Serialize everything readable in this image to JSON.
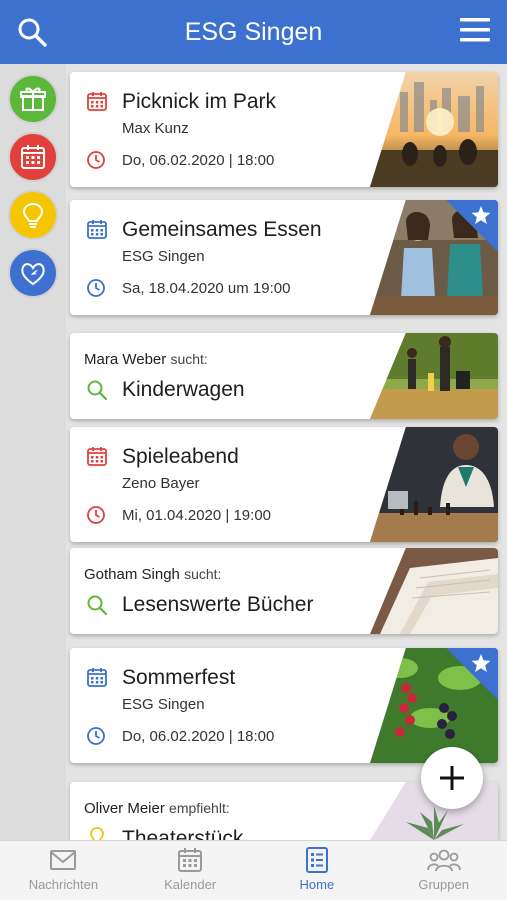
{
  "header": {
    "title": "ESG Singen"
  },
  "categories": [
    {
      "name": "gift",
      "color": "#5cb83a"
    },
    {
      "name": "calendar",
      "color": "#e2403a"
    },
    {
      "name": "idea",
      "color": "#f5c600"
    },
    {
      "name": "dove-heart",
      "color": "#3c71d0"
    }
  ],
  "cards": [
    {
      "title": "Picknick im Park",
      "organizer": "Max Kunz",
      "date": "Do, 06.02.2020 | 18:00"
    },
    {
      "title": "Gemeinsames Essen",
      "organizer": "ESG Singen",
      "date": "Sa, 18.04.2020 um 19:00"
    },
    {
      "who": "Mara Weber",
      "verb": "sucht:",
      "item": "Kinderwagen"
    },
    {
      "title": "Spieleabend",
      "organizer": "Zeno Bayer",
      "date": "Mi, 01.04.2020 | 19:00"
    },
    {
      "who": "Gotham Singh",
      "verb": "sucht:",
      "item": "Lesenswerte Bücher"
    },
    {
      "title": "Sommerfest",
      "organizer": "ESG Singen",
      "date": "Do, 06.02.2020 | 18:00"
    },
    {
      "who": "Oliver Meier",
      "verb": "empfiehlt:",
      "item": "Theaterstück"
    }
  ],
  "nav": [
    {
      "label": "Nachrichten"
    },
    {
      "label": "Kalender"
    },
    {
      "label": "Home"
    },
    {
      "label": "Gruppen"
    }
  ]
}
